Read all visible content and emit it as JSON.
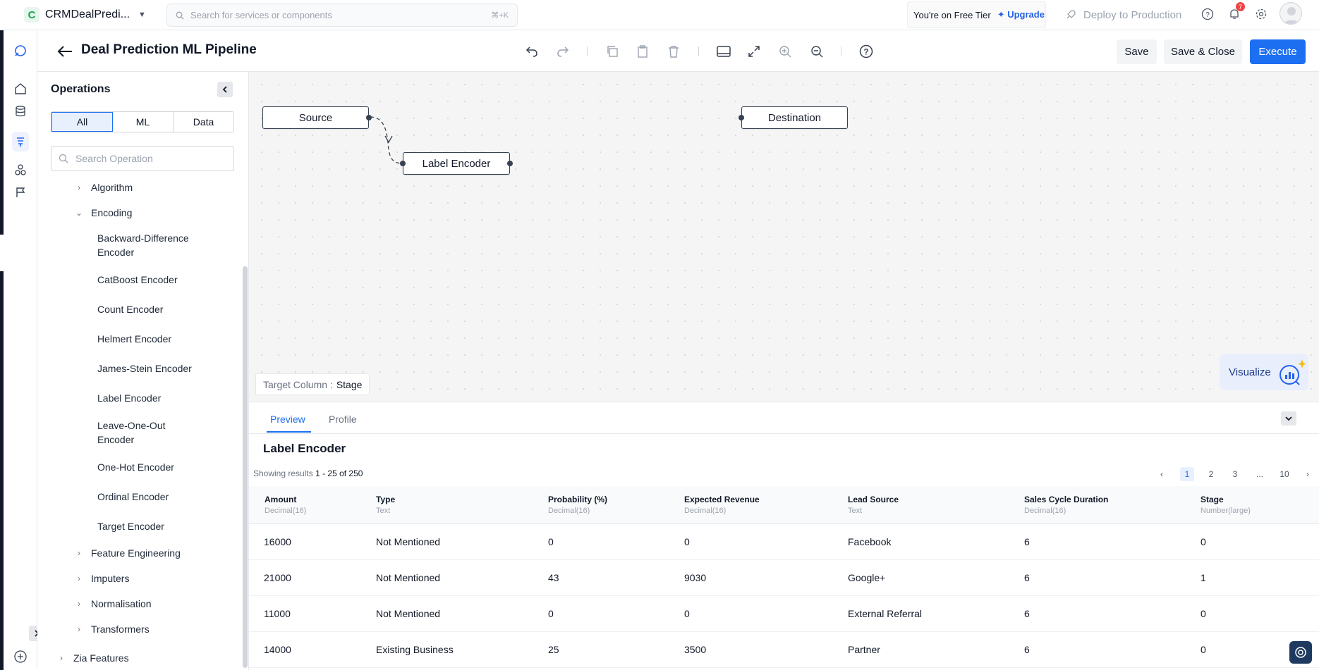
{
  "topbar": {
    "project_initial": "C",
    "project_name": "CRMDealPredi...",
    "search_placeholder": "Search for services or components",
    "search_shortcut": "⌘+K",
    "tier_text": "You're on Free Tier",
    "upgrade_label": "Upgrade",
    "deploy_label": "Deploy to Production",
    "notification_count": "7"
  },
  "header": {
    "title": "Deal Prediction ML Pipeline",
    "save_label": "Save",
    "save_close_label": "Save & Close",
    "execute_label": "Execute"
  },
  "operations": {
    "title": "Operations",
    "filters": [
      "All",
      "ML",
      "Data"
    ],
    "active_filter": "All",
    "search_placeholder": "Search Operation",
    "tree": {
      "algorithm": "Algorithm",
      "encoding": "Encoding",
      "encoders": [
        "Backward-Difference Encoder",
        "CatBoost Encoder",
        "Count Encoder",
        "Helmert Encoder",
        "James-Stein Encoder",
        "Label Encoder",
        "Leave-One-Out Encoder",
        "One-Hot Encoder",
        "Ordinal Encoder",
        "Target Encoder"
      ],
      "feature_engineering": "Feature Engineering",
      "imputers": "Imputers",
      "normalisation": "Normalisation",
      "transformers": "Transformers",
      "zia_features": "Zia Features"
    }
  },
  "canvas": {
    "nodes": {
      "source": "Source",
      "label_encoder": "Label Encoder",
      "destination": "Destination"
    },
    "target_column_label": "Target Column :",
    "target_column_value": "Stage",
    "visualize_label": "Visualize"
  },
  "preview": {
    "tabs": [
      "Preview",
      "Profile"
    ],
    "active_tab": "Preview",
    "section_title": "Label Encoder",
    "showing_prefix": "Showing results",
    "showing_range": "1 - 25 of 250",
    "pages": [
      "1",
      "2",
      "3",
      "...",
      "10"
    ],
    "current_page": "1",
    "columns": [
      {
        "name": "Amount",
        "type": "Decimal(16)"
      },
      {
        "name": "Type",
        "type": "Text"
      },
      {
        "name": "Probability (%)",
        "type": "Decimal(16)"
      },
      {
        "name": "Expected Revenue",
        "type": "Decimal(16)"
      },
      {
        "name": "Lead Source",
        "type": "Text"
      },
      {
        "name": "Sales Cycle Duration",
        "type": "Decimal(16)"
      },
      {
        "name": "Stage",
        "type": "Number(large)"
      }
    ],
    "rows": [
      [
        "16000",
        "Not Mentioned",
        "0",
        "0",
        "Facebook",
        "6",
        "0"
      ],
      [
        "21000",
        "Not Mentioned",
        "43",
        "9030",
        "Google+",
        "6",
        "1"
      ],
      [
        "11000",
        "Not Mentioned",
        "0",
        "0",
        "External Referral",
        "6",
        "0"
      ],
      [
        "14000",
        "Existing Business",
        "25",
        "3500",
        "Partner",
        "6",
        "0"
      ]
    ]
  }
}
